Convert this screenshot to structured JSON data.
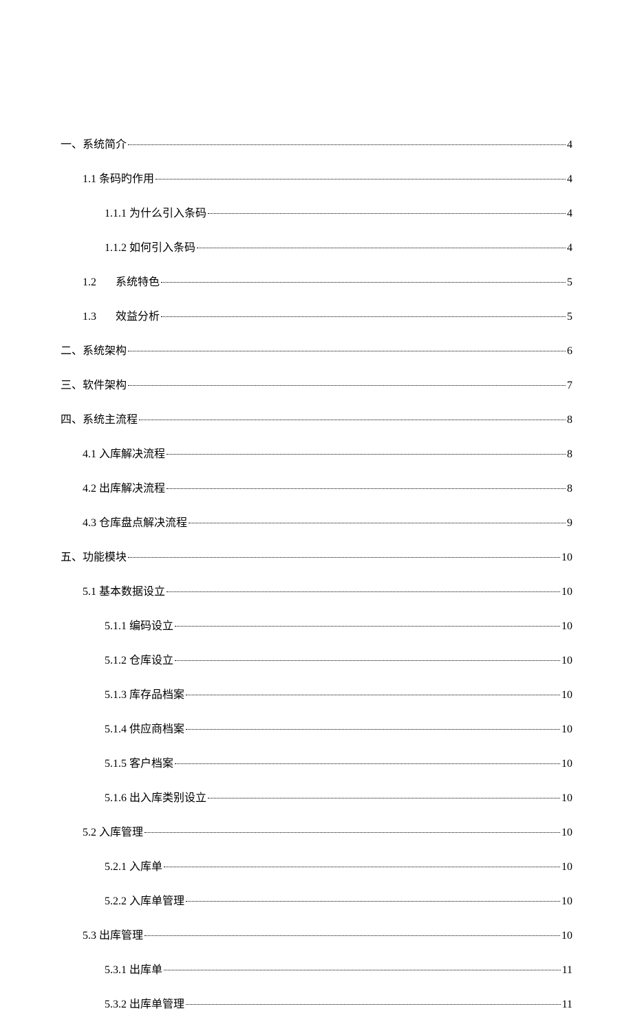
{
  "toc": [
    {
      "level": 0,
      "num": "一、",
      "title": "系统简介",
      "page": "4",
      "gap": false
    },
    {
      "level": 1,
      "num": "1.1",
      "title": "条码旳作用",
      "page": "4",
      "gap": false,
      "space": " "
    },
    {
      "level": 2,
      "num": "1.1.1",
      "title": "为什么引入条码",
      "page": "4",
      "gap": false,
      "space": " "
    },
    {
      "level": 2,
      "num": "1.1.2",
      "title": "如何引入条码",
      "page": "4",
      "gap": false,
      "space": " "
    },
    {
      "level": 1,
      "num": "1.2",
      "title": "系统特色",
      "page": "5",
      "gap": true
    },
    {
      "level": 1,
      "num": "1.3",
      "title": "效益分析",
      "page": "5",
      "gap": true
    },
    {
      "level": 0,
      "num": "二、",
      "title": "系统架构",
      "page": "6",
      "gap": false
    },
    {
      "level": 0,
      "num": "三、",
      "title": "软件架构",
      "page": "7",
      "gap": false
    },
    {
      "level": 0,
      "num": "四、",
      "title": "系统主流程",
      "page": "8",
      "gap": false
    },
    {
      "level": 1,
      "num": "4.1",
      "title": "入库解决流程",
      "page": "8",
      "gap": false,
      "space": "  "
    },
    {
      "level": 1,
      "num": "4.2",
      "title": "出库解决流程",
      "page": "8",
      "gap": false,
      "space": "  "
    },
    {
      "level": 1,
      "num": "4.3",
      "title": "仓库盘点解决流程",
      "page": "9",
      "gap": false,
      "space": "  "
    },
    {
      "level": 0,
      "num": "五、",
      "title": "功能模块",
      "page": "10",
      "gap": false
    },
    {
      "level": 1,
      "num": "5.1",
      "title": "基本数据设立",
      "page": "10",
      "gap": false,
      "space": "  "
    },
    {
      "level": 2,
      "num": "5.1.1",
      "title": "编码设立",
      "page": "10",
      "gap": false,
      "space": "  "
    },
    {
      "level": 2,
      "num": "5.1.2",
      "title": "仓库设立",
      "page": "10",
      "gap": false,
      "space": "  "
    },
    {
      "level": 2,
      "num": "5.1.3",
      "title": "库存品档案",
      "page": "10",
      "gap": false,
      "space": "  "
    },
    {
      "level": 2,
      "num": "5.1.4",
      "title": "供应商档案",
      "page": "10",
      "gap": false,
      "space": "  "
    },
    {
      "level": 2,
      "num": "5.1.5",
      "title": "客户档案",
      "page": "10",
      "gap": false,
      "space": "  "
    },
    {
      "level": 2,
      "num": "5.1.6",
      "title": "出入库类别设立",
      "page": "10",
      "gap": false,
      "space": "  "
    },
    {
      "level": 1,
      "num": "5.2",
      "title": "入库管理",
      "page": "10",
      "gap": false,
      "space": "  "
    },
    {
      "level": 2,
      "num": "5.2.1",
      "title": "入库单",
      "page": "10",
      "gap": false,
      "space": "  "
    },
    {
      "level": 2,
      "num": "5.2.2",
      "title": "入库单管理",
      "page": "10",
      "gap": false,
      "space": "  "
    },
    {
      "level": 1,
      "num": "5.3",
      "title": "出库管理",
      "page": "10",
      "gap": false,
      "space": "  "
    },
    {
      "level": 2,
      "num": "5.3.1",
      "title": "出库单",
      "page": "11",
      "gap": false,
      "space": "  "
    },
    {
      "level": 2,
      "num": "5.3.2",
      "title": "出库单管理",
      "page": "11",
      "gap": false,
      "space": "  "
    }
  ]
}
